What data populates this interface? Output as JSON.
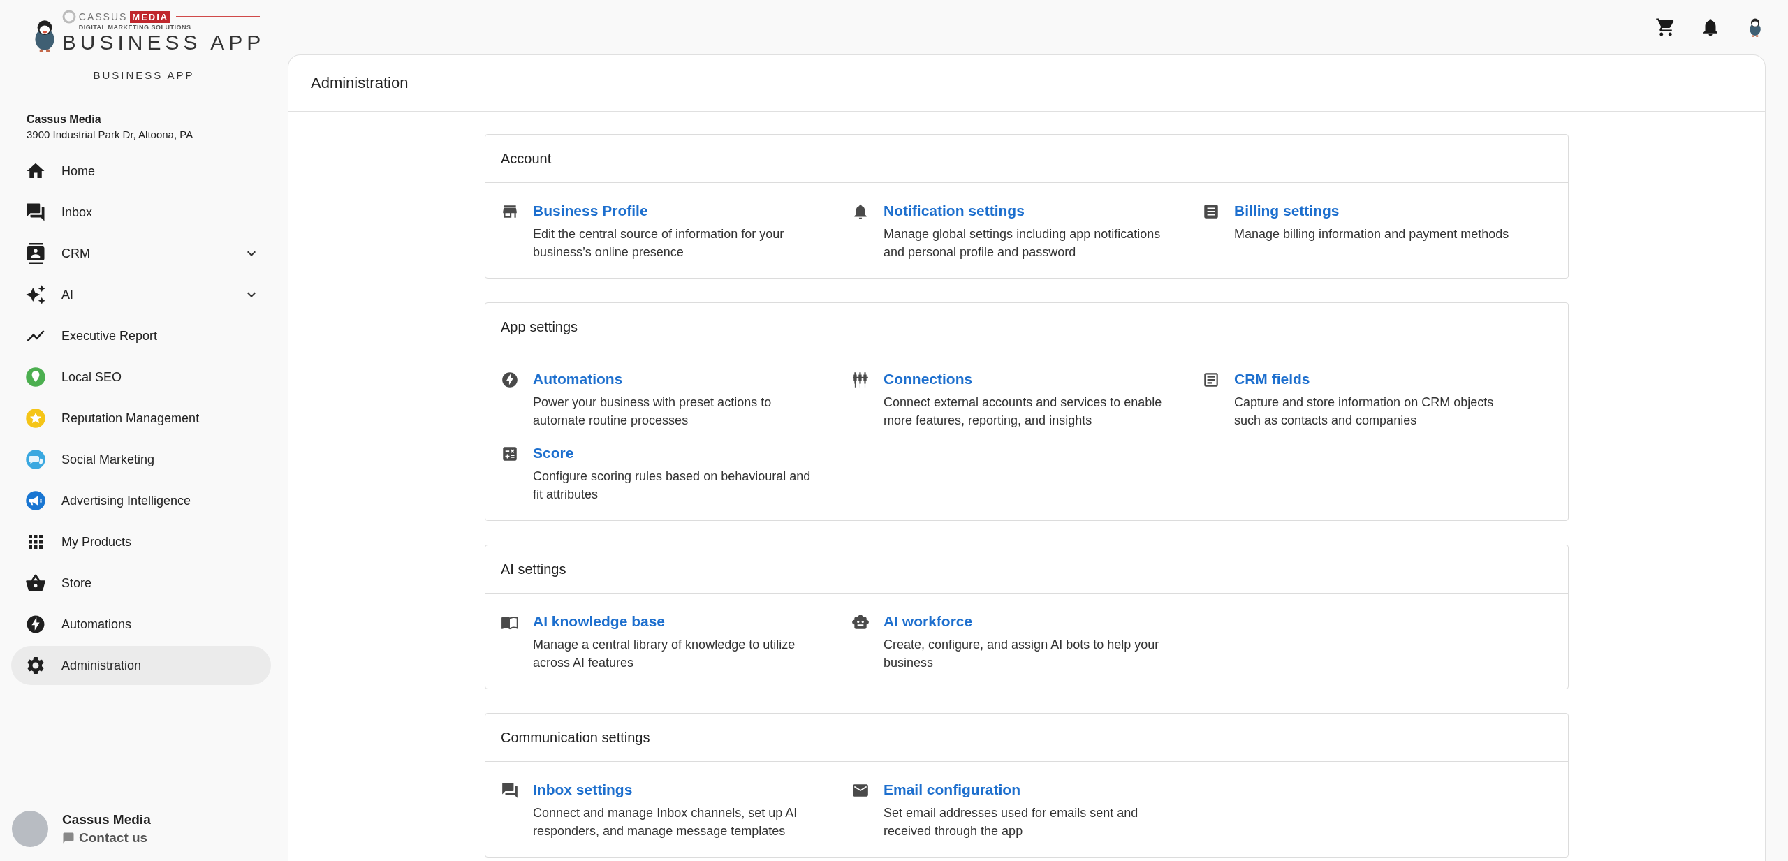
{
  "logo": {
    "brand": "CASSUS",
    "brand_highlight": "MEDIA",
    "tagline": "DIGITAL MARKETING SOLUTIONS",
    "wordmark": "BUSINESS APP"
  },
  "app_name": "BUSINESS APP",
  "company": {
    "name": "Cassus Media",
    "address": "3900 Industrial Park Dr, Altoona, PA"
  },
  "sidebar": {
    "items": [
      {
        "label": "Home",
        "selected": false,
        "has_submenu": false
      },
      {
        "label": "Inbox",
        "selected": false,
        "has_submenu": false
      },
      {
        "label": "CRM",
        "selected": false,
        "has_submenu": true
      },
      {
        "label": "AI",
        "selected": false,
        "has_submenu": true
      },
      {
        "label": "Executive Report",
        "selected": false,
        "has_submenu": false
      },
      {
        "label": "Local SEO",
        "selected": false,
        "has_submenu": false
      },
      {
        "label": "Reputation Management",
        "selected": false,
        "has_submenu": false
      },
      {
        "label": "Social Marketing",
        "selected": false,
        "has_submenu": false
      },
      {
        "label": "Advertising Intelligence",
        "selected": false,
        "has_submenu": false
      },
      {
        "label": "My Products",
        "selected": false,
        "has_submenu": false
      },
      {
        "label": "Store",
        "selected": false,
        "has_submenu": false
      },
      {
        "label": "Automations",
        "selected": false,
        "has_submenu": false
      },
      {
        "label": "Administration",
        "selected": true,
        "has_submenu": false
      }
    ]
  },
  "footer": {
    "name": "Cassus Media",
    "contact": "Contact us"
  },
  "page": {
    "title": "Administration",
    "sections": [
      {
        "title": "Account",
        "items": [
          {
            "title": "Business Profile",
            "description": "Edit the central source of information for your business’s online presence"
          },
          {
            "title": "Notification settings",
            "description": "Manage global settings including app notifications and personal profile and password"
          },
          {
            "title": "Billing settings",
            "description": "Manage billing information and payment methods"
          }
        ]
      },
      {
        "title": "App settings",
        "items": [
          {
            "title": "Automations",
            "description": "Power your business with preset actions to automate routine processes"
          },
          {
            "title": "Connections",
            "description": "Connect external accounts and services to enable more features, reporting, and insights"
          },
          {
            "title": "CRM fields",
            "description": "Capture and store information on CRM objects such as contacts and companies"
          },
          {
            "title": "Score",
            "description": "Configure scoring rules based on behavioural and fit attributes"
          }
        ]
      },
      {
        "title": "AI settings",
        "items": [
          {
            "title": "AI knowledge base",
            "description": "Manage a central library of knowledge to utilize across AI features"
          },
          {
            "title": "AI workforce",
            "description": "Create, configure, and assign AI bots to help your business"
          }
        ]
      },
      {
        "title": "Communication settings",
        "items": [
          {
            "title": "Inbox settings",
            "description": "Connect and manage Inbox channels, set up AI responders, and manage message templates"
          },
          {
            "title": "Email configuration",
            "description": "Set email addresses used for emails sent and received through the app"
          }
        ]
      }
    ]
  }
}
